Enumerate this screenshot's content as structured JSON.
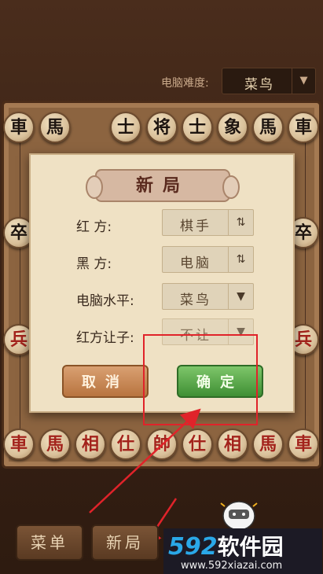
{
  "top": {
    "difficulty_label": "电脑难度:",
    "difficulty_value": "菜鸟"
  },
  "board": {
    "top_row": [
      "車",
      "馬",
      "士",
      "将",
      "士",
      "象",
      "馬",
      "車"
    ],
    "top_side": [
      "卒",
      "卒"
    ],
    "bottom_row": [
      "車",
      "馬",
      "相",
      "仕",
      "帥",
      "仕",
      "相",
      "馬",
      "車"
    ],
    "side_soldiers": [
      "兵",
      "兵"
    ]
  },
  "dialog": {
    "title": "新局",
    "rows": [
      {
        "label": "红    方:",
        "value": "棋手",
        "control": "⇅"
      },
      {
        "label": "黑    方:",
        "value": "电脑",
        "control": "⇅"
      },
      {
        "label": "电脑水平:",
        "value": "菜鸟",
        "control": "▼"
      },
      {
        "label": "红方让子:",
        "value": "不让",
        "control": "▼"
      }
    ],
    "cancel": "取消",
    "confirm": "确定"
  },
  "bottom": {
    "menu": "菜单",
    "new_game": "新局"
  },
  "watermark": {
    "main": "592",
    "main_cn": "软件园",
    "sub": "www.592xiazai.com"
  },
  "colors": {
    "confirm": "#4fa03f",
    "cancel": "#c9834e",
    "annotation": "#e0232a"
  }
}
